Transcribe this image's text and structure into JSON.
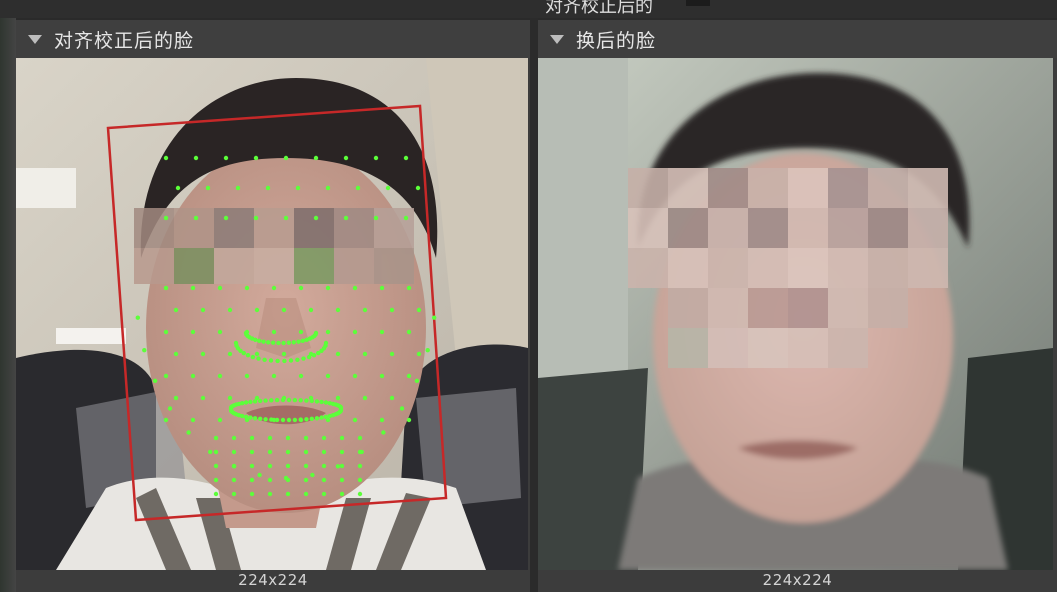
{
  "top_strip": {
    "clipped_text": "对齐校正后的"
  },
  "panels": [
    {
      "title": "对齐校正后的脸",
      "caption": "224x224",
      "image_content": "aligned face with 68 green landmark points and red bounding box"
    },
    {
      "title": "换后的脸",
      "caption": "224x224",
      "image_content": "swapped face result"
    }
  ],
  "colors": {
    "panel_bg": "#3c3c3c",
    "header_bg": "#3f3f3f",
    "text": "#e6e6e6",
    "bbox": "#c62828",
    "landmark": "#5cff3a"
  },
  "icons": {
    "collapse": "triangle-down-icon"
  }
}
